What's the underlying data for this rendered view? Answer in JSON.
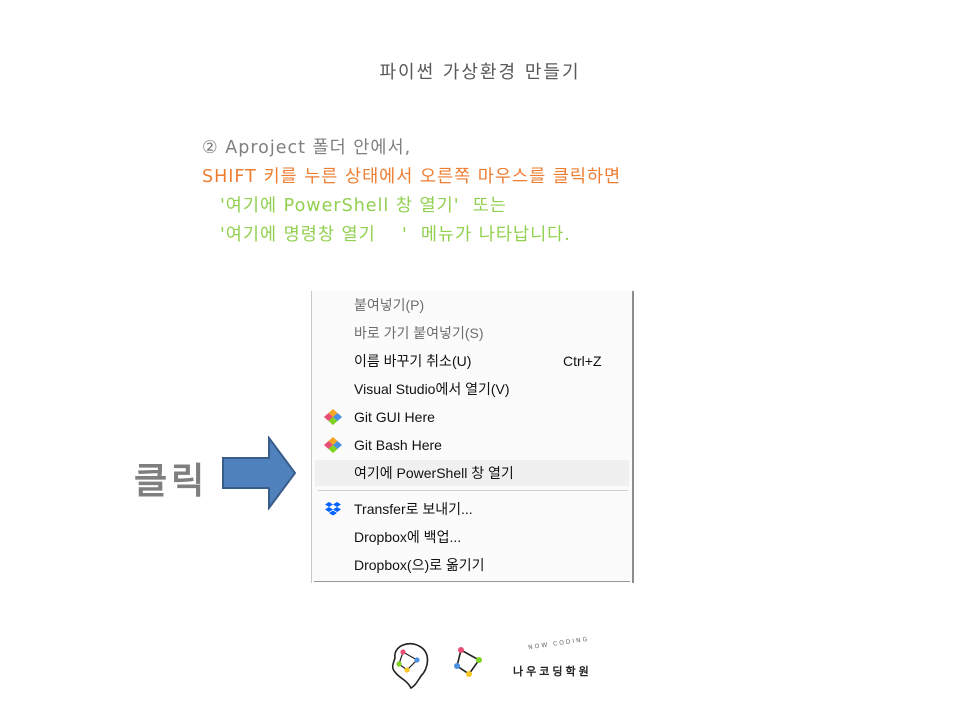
{
  "title": "파이썬 가상환경 만들기",
  "instructions": {
    "line1": "② Aproject 폴더 안에서,",
    "line2": "SHIFT 키를 누른 상태에서 오른쪽 마우스를 클릭하면",
    "line3": "'여기에 PowerShell 창 열기'  또는",
    "line4": "'여기에 명령창 열기    '  메뉴가 나타납니다."
  },
  "click_label": "클릭",
  "context_menu": {
    "item_paste": "붙여넣기(P)",
    "item_paste_shortcut": "바로 가기 붙여넣기(S)",
    "item_undo_rename": "이름 바꾸기 취소(U)",
    "item_undo_rename_shortcut": "Ctrl+Z",
    "item_visual_studio": "Visual Studio에서 열기(V)",
    "item_git_gui": "Git GUI Here",
    "item_git_bash": "Git Bash Here",
    "item_powershell": "여기에 PowerShell 창 열기",
    "item_transfer": "Transfer로 보내기...",
    "item_dropbox_backup": "Dropbox에 백업...",
    "item_dropbox_move": "Dropbox(으)로 옮기기"
  },
  "logo": {
    "name": "나우코딩학원",
    "tagline": "NOW CODING"
  },
  "colors": {
    "orange": "#ed7d31",
    "green": "#92d050",
    "arrow": "#4f81bd"
  }
}
